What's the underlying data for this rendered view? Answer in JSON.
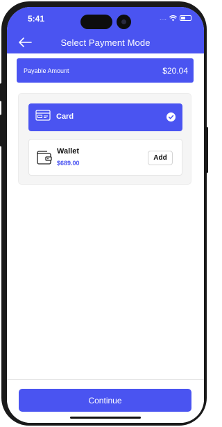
{
  "status_bar": {
    "time": "5:41",
    "signal": "....",
    "wifi_icon": "wifi-icon",
    "battery_icon": "battery-icon"
  },
  "header": {
    "back_icon": "arrow-left-icon",
    "title": "Select Payment Mode"
  },
  "payable": {
    "label": "Payable Amount",
    "amount": "$20.04"
  },
  "payment_options": [
    {
      "label": "Card",
      "icon": "credit-card-icon",
      "selected": true
    },
    {
      "label": "Wallet",
      "icon": "wallet-icon",
      "balance": "$689.00",
      "action": "Add",
      "selected": false
    }
  ],
  "footer": {
    "continue_label": "Continue"
  },
  "colors": {
    "primary": "#4a54f1",
    "background": "#ffffff",
    "panel": "#f5f5f5"
  }
}
